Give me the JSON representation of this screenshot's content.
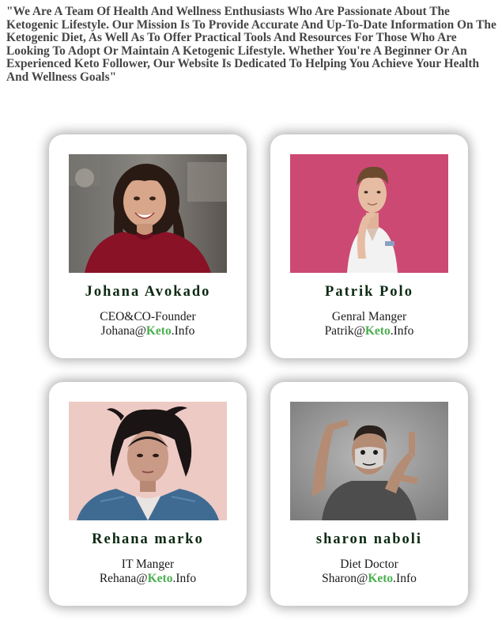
{
  "mission": {
    "text": "\"We Are A Team Of Health And Wellness Enthusiasts Who Are Passionate About The Ketogenic Lifestyle. Our Mission Is To Provide Accurate And Up-To-Date Information On The Ketogenic Diet, As Well As To Offer Practical Tools And Resources For Those Who Are Looking To Adopt Or Maintain A Ketogenic Lifestyle. Whether You're A Beginner Or An Experienced Keto Follower, Our Website Is Dedicated To Helping You Achieve Your Health And Wellness Goals\""
  },
  "colors": {
    "brand_green": "#4caf50",
    "name_color": "#0d2a12",
    "mission_text": "#454545"
  },
  "team": [
    {
      "name": "Johana Avokado",
      "role": "CEO&CO-Founder",
      "email_user": "Johana@",
      "email_brand": "Keto",
      "email_tld": ".Info",
      "photo": "woman-red-top-photo"
    },
    {
      "name": "Patrik Polo",
      "role": "Genral Manger",
      "email_user": "Patrik@",
      "email_brand": "Keto",
      "email_tld": ".Info",
      "photo": "man-pink-background-photo"
    },
    {
      "name": "Rehana marko",
      "role": "IT Manger",
      "email_user": "Rehana@",
      "email_brand": "Keto",
      "email_tld": ".Info",
      "photo": "woman-denim-jacket-photo"
    },
    {
      "name": "sharon naboli",
      "role": "Diet Doctor",
      "email_user": "Sharon@",
      "email_brand": "Keto",
      "email_tld": ".Info",
      "photo": "man-face-paint-photo"
    }
  ]
}
